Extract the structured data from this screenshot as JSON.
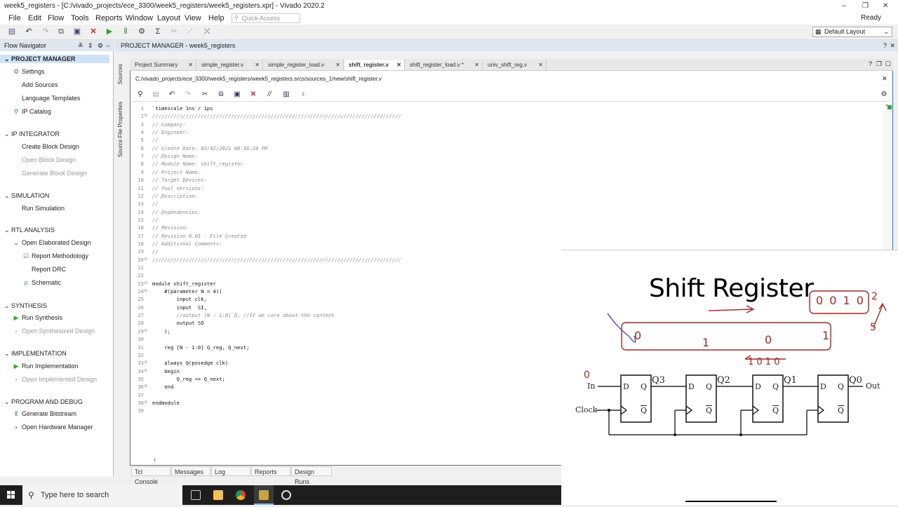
{
  "window": {
    "title": "week5_registers - [C:/vivado_projects/ece_3300/week5_registers/week5_registers.xpr] - Vivado 2020.2",
    "status": "Ready"
  },
  "menu": [
    "File",
    "Edit",
    "Flow",
    "Tools",
    "Reports",
    "Window",
    "Layout",
    "View",
    "Help"
  ],
  "quick_access": "Quick Access",
  "layout": "Default Layout",
  "flow_navigator": {
    "title": "Flow Navigator",
    "sections": [
      {
        "title": "PROJECT MANAGER",
        "items": [
          "Settings",
          "Add Sources",
          "Language Templates",
          "IP Catalog"
        ]
      },
      {
        "title": "IP INTEGRATOR",
        "items": [
          "Create Block Design",
          "Open Block Design",
          "Generate Block Design"
        ]
      },
      {
        "title": "SIMULATION",
        "items": [
          "Run Simulation"
        ]
      },
      {
        "title": "RTL ANALYSIS",
        "items": [
          "Open Elaborated Design",
          "Report Methodology",
          "Report DRC",
          "Schematic"
        ]
      },
      {
        "title": "SYNTHESIS",
        "items": [
          "Run Synthesis",
          "Open Synthesized Design"
        ]
      },
      {
        "title": "IMPLEMENTATION",
        "items": [
          "Run Implementation",
          "Open Implemented Design"
        ]
      },
      {
        "title": "PROGRAM AND DEBUG",
        "items": [
          "Generate Bitstream",
          "Open Hardware Manager"
        ]
      }
    ]
  },
  "pm_header": "PROJECT MANAGER - week5_registers",
  "side_tabs": [
    "Sources",
    "Source File Properties"
  ],
  "tabs": [
    "Project Summary",
    "simple_register.v",
    "simple_register_load.v",
    "shift_register.v",
    "shift_register_load.v *",
    "univ_shift_reg.v"
  ],
  "file_path": "C:/vivado_projects/ece_3300/week5_registers/week5_registers.srcs/sources_1/new/shift_register.v",
  "code_lines": [
    "`timescale 1ns / 1ps",
    "//////////////////////////////////////////////////////////////////////////////////",
    "// Company:",
    "// Engineer:",
    "//",
    "// Create Date: 03/02/2021 08:58:28 PM",
    "// Design Name:",
    "// Module Name: shift_register",
    "// Project Name:",
    "// Target Devices:",
    "// Tool Versions:",
    "// Description:",
    "//",
    "// Dependencies:",
    "//",
    "// Revision:",
    "// Revision 0.01 - File Created",
    "// Additional Comments:",
    "//",
    "//////////////////////////////////////////////////////////////////////////////////",
    "",
    "",
    "module shift_register",
    "    #(parameter N = 4)(",
    "        input clk,",
    "        input  SI,",
    "        //output [N - 1:0] Q, //If we care about the content",
    "        output SO",
    "    );",
    "",
    "    reg [N - 1:0] Q_reg, Q_next;",
    "",
    "    always @(posedge clk)",
    "    begin",
    "        Q_reg <= Q_next;",
    "    end",
    "",
    "endmodule",
    ""
  ],
  "bottom_tabs": [
    "Tcl Console",
    "Messages",
    "Log",
    "Reports",
    "Design Runs"
  ],
  "taskbar": {
    "search_placeholder": "Type here to search"
  },
  "slide": {
    "title": "Shift Register",
    "ff_labels": [
      "Q3",
      "Q2",
      "Q1",
      "Q0"
    ],
    "in_label": "In",
    "out_label": "Out",
    "clock_label": "Clock",
    "handwriting": {
      "top_bits": "0 0 1 0",
      "right_marks": [
        "2",
        "5"
      ],
      "bar_digits": [
        "0",
        "1",
        "0",
        "1"
      ],
      "below_bits": "1 0 1 0",
      "in_zero": "0"
    }
  },
  "colors": {
    "accent": "#3a78c4",
    "header_bg": "#dfe6ee",
    "run_green": "#2fa82f",
    "ink_red": "#b3261e",
    "ink_blue": "#6a5acd"
  }
}
